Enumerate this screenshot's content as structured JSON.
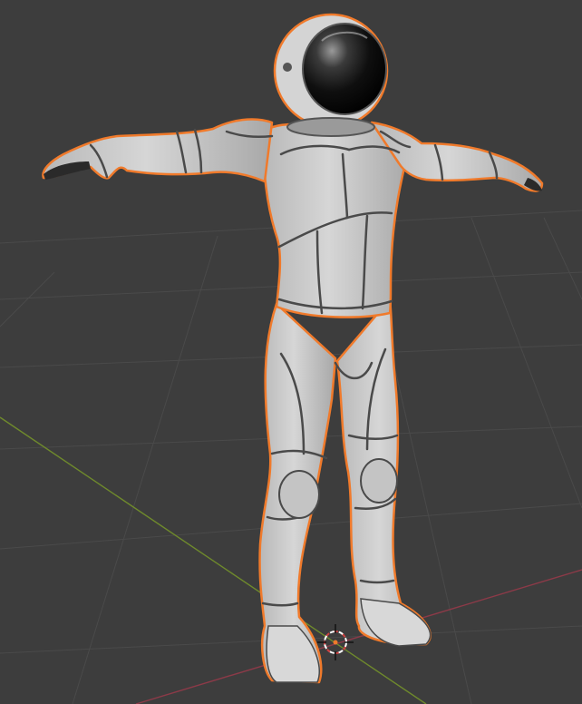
{
  "viewport": {
    "mode": "3d-viewport-object-selected",
    "background_color": "#3d3d3d",
    "grid_color": "#4a4a4a",
    "x_axis_color": "#8c3a48",
    "y_axis_color": "#6f8a2c",
    "selection_outline_color": "#f07a2b"
  },
  "model": {
    "icon": "astronaut-model",
    "selected": true
  },
  "cursor": {
    "icon": "3d-cursor-icon"
  }
}
